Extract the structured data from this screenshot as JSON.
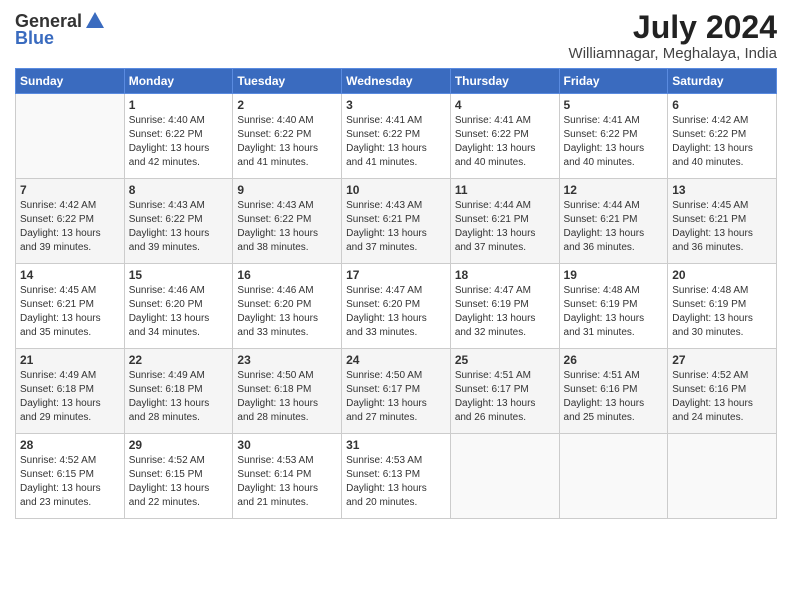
{
  "header": {
    "logo_general": "General",
    "logo_blue": "Blue",
    "title": "July 2024",
    "location": "Williamnagar, Meghalaya, India"
  },
  "calendar": {
    "days_of_week": [
      "Sunday",
      "Monday",
      "Tuesday",
      "Wednesday",
      "Thursday",
      "Friday",
      "Saturday"
    ],
    "weeks": [
      [
        {
          "day": "",
          "detail": ""
        },
        {
          "day": "1",
          "detail": "Sunrise: 4:40 AM\nSunset: 6:22 PM\nDaylight: 13 hours\nand 42 minutes."
        },
        {
          "day": "2",
          "detail": "Sunrise: 4:40 AM\nSunset: 6:22 PM\nDaylight: 13 hours\nand 41 minutes."
        },
        {
          "day": "3",
          "detail": "Sunrise: 4:41 AM\nSunset: 6:22 PM\nDaylight: 13 hours\nand 41 minutes."
        },
        {
          "day": "4",
          "detail": "Sunrise: 4:41 AM\nSunset: 6:22 PM\nDaylight: 13 hours\nand 40 minutes."
        },
        {
          "day": "5",
          "detail": "Sunrise: 4:41 AM\nSunset: 6:22 PM\nDaylight: 13 hours\nand 40 minutes."
        },
        {
          "day": "6",
          "detail": "Sunrise: 4:42 AM\nSunset: 6:22 PM\nDaylight: 13 hours\nand 40 minutes."
        }
      ],
      [
        {
          "day": "7",
          "detail": "Sunrise: 4:42 AM\nSunset: 6:22 PM\nDaylight: 13 hours\nand 39 minutes."
        },
        {
          "day": "8",
          "detail": "Sunrise: 4:43 AM\nSunset: 6:22 PM\nDaylight: 13 hours\nand 39 minutes."
        },
        {
          "day": "9",
          "detail": "Sunrise: 4:43 AM\nSunset: 6:22 PM\nDaylight: 13 hours\nand 38 minutes."
        },
        {
          "day": "10",
          "detail": "Sunrise: 4:43 AM\nSunset: 6:21 PM\nDaylight: 13 hours\nand 37 minutes."
        },
        {
          "day": "11",
          "detail": "Sunrise: 4:44 AM\nSunset: 6:21 PM\nDaylight: 13 hours\nand 37 minutes."
        },
        {
          "day": "12",
          "detail": "Sunrise: 4:44 AM\nSunset: 6:21 PM\nDaylight: 13 hours\nand 36 minutes."
        },
        {
          "day": "13",
          "detail": "Sunrise: 4:45 AM\nSunset: 6:21 PM\nDaylight: 13 hours\nand 36 minutes."
        }
      ],
      [
        {
          "day": "14",
          "detail": "Sunrise: 4:45 AM\nSunset: 6:21 PM\nDaylight: 13 hours\nand 35 minutes."
        },
        {
          "day": "15",
          "detail": "Sunrise: 4:46 AM\nSunset: 6:20 PM\nDaylight: 13 hours\nand 34 minutes."
        },
        {
          "day": "16",
          "detail": "Sunrise: 4:46 AM\nSunset: 6:20 PM\nDaylight: 13 hours\nand 33 minutes."
        },
        {
          "day": "17",
          "detail": "Sunrise: 4:47 AM\nSunset: 6:20 PM\nDaylight: 13 hours\nand 33 minutes."
        },
        {
          "day": "18",
          "detail": "Sunrise: 4:47 AM\nSunset: 6:19 PM\nDaylight: 13 hours\nand 32 minutes."
        },
        {
          "day": "19",
          "detail": "Sunrise: 4:48 AM\nSunset: 6:19 PM\nDaylight: 13 hours\nand 31 minutes."
        },
        {
          "day": "20",
          "detail": "Sunrise: 4:48 AM\nSunset: 6:19 PM\nDaylight: 13 hours\nand 30 minutes."
        }
      ],
      [
        {
          "day": "21",
          "detail": "Sunrise: 4:49 AM\nSunset: 6:18 PM\nDaylight: 13 hours\nand 29 minutes."
        },
        {
          "day": "22",
          "detail": "Sunrise: 4:49 AM\nSunset: 6:18 PM\nDaylight: 13 hours\nand 28 minutes."
        },
        {
          "day": "23",
          "detail": "Sunrise: 4:50 AM\nSunset: 6:18 PM\nDaylight: 13 hours\nand 28 minutes."
        },
        {
          "day": "24",
          "detail": "Sunrise: 4:50 AM\nSunset: 6:17 PM\nDaylight: 13 hours\nand 27 minutes."
        },
        {
          "day": "25",
          "detail": "Sunrise: 4:51 AM\nSunset: 6:17 PM\nDaylight: 13 hours\nand 26 minutes."
        },
        {
          "day": "26",
          "detail": "Sunrise: 4:51 AM\nSunset: 6:16 PM\nDaylight: 13 hours\nand 25 minutes."
        },
        {
          "day": "27",
          "detail": "Sunrise: 4:52 AM\nSunset: 6:16 PM\nDaylight: 13 hours\nand 24 minutes."
        }
      ],
      [
        {
          "day": "28",
          "detail": "Sunrise: 4:52 AM\nSunset: 6:15 PM\nDaylight: 13 hours\nand 23 minutes."
        },
        {
          "day": "29",
          "detail": "Sunrise: 4:52 AM\nSunset: 6:15 PM\nDaylight: 13 hours\nand 22 minutes."
        },
        {
          "day": "30",
          "detail": "Sunrise: 4:53 AM\nSunset: 6:14 PM\nDaylight: 13 hours\nand 21 minutes."
        },
        {
          "day": "31",
          "detail": "Sunrise: 4:53 AM\nSunset: 6:13 PM\nDaylight: 13 hours\nand 20 minutes."
        },
        {
          "day": "",
          "detail": ""
        },
        {
          "day": "",
          "detail": ""
        },
        {
          "day": "",
          "detail": ""
        }
      ]
    ]
  }
}
